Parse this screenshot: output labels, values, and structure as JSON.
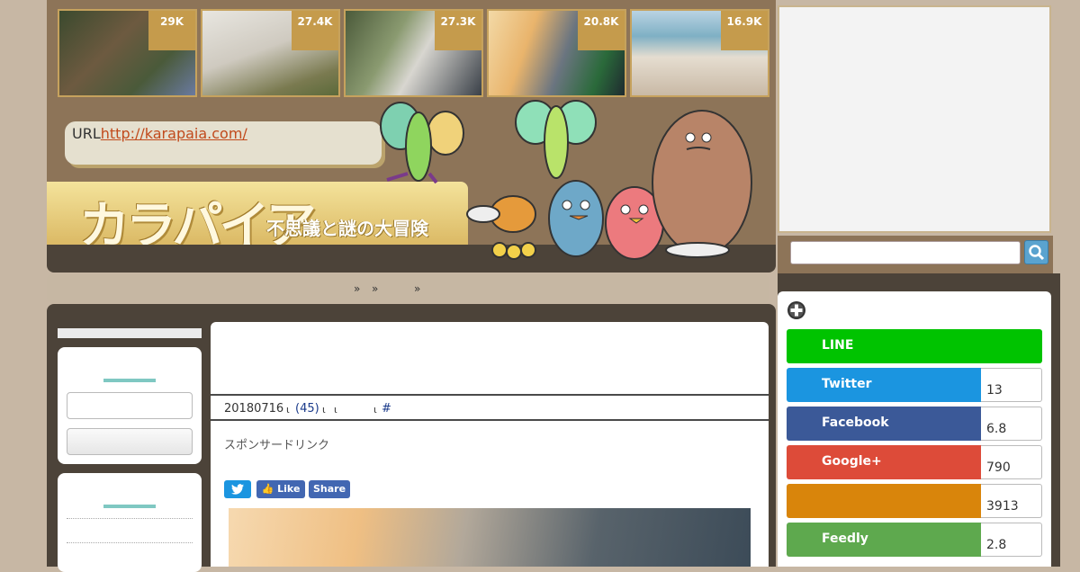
{
  "thumbnails": [
    {
      "count": "29K",
      "icon": "dog-in-grass-photo"
    },
    {
      "count": "27.4K",
      "icon": "white-dog-photo"
    },
    {
      "count": "27.3K",
      "icon": "cat-in-car-photo"
    },
    {
      "count": "20.8K",
      "icon": "fuel-pump-photo"
    },
    {
      "count": "16.9K",
      "icon": "littered-beach-photo"
    }
  ],
  "header": {
    "url_label": "URL",
    "url_link": "http://karapaia.com/",
    "logo_text": "カラパイア",
    "tagline": "不思議と謎の大冒険"
  },
  "breadcrumb": {
    "sep1": "»",
    "sep2": "»",
    "sep3": "»"
  },
  "article": {
    "title": "",
    "date": "20180716",
    "sep_a": "ι",
    "comments": "(45)",
    "sep_b": "ι",
    "sep_c": "ι",
    "sep_d": "ι",
    "hash": "#",
    "sponsor": "スポンサードリンク",
    "share": {
      "like": "Like",
      "share": "Share"
    }
  },
  "sns": [
    {
      "name": "LINE",
      "count": "",
      "color": "#00c300"
    },
    {
      "name": "Twitter",
      "count": "13",
      "color": "#1b95e0"
    },
    {
      "name": "Facebook",
      "count": "6.8",
      "color": "#3b5998"
    },
    {
      "name": "Google+",
      "count": "790",
      "color": "#dd4b39"
    },
    {
      "name": "",
      "count": "3913",
      "color": "#d9850b"
    },
    {
      "name": "Feedly",
      "count": "2.8",
      "color": "#5ea94e"
    }
  ],
  "colors": {
    "header_brown": "#8d7458",
    "dark_band": "#4c4339",
    "title_blue": "#1a2a70",
    "badge_gold": "#c59b4c"
  }
}
